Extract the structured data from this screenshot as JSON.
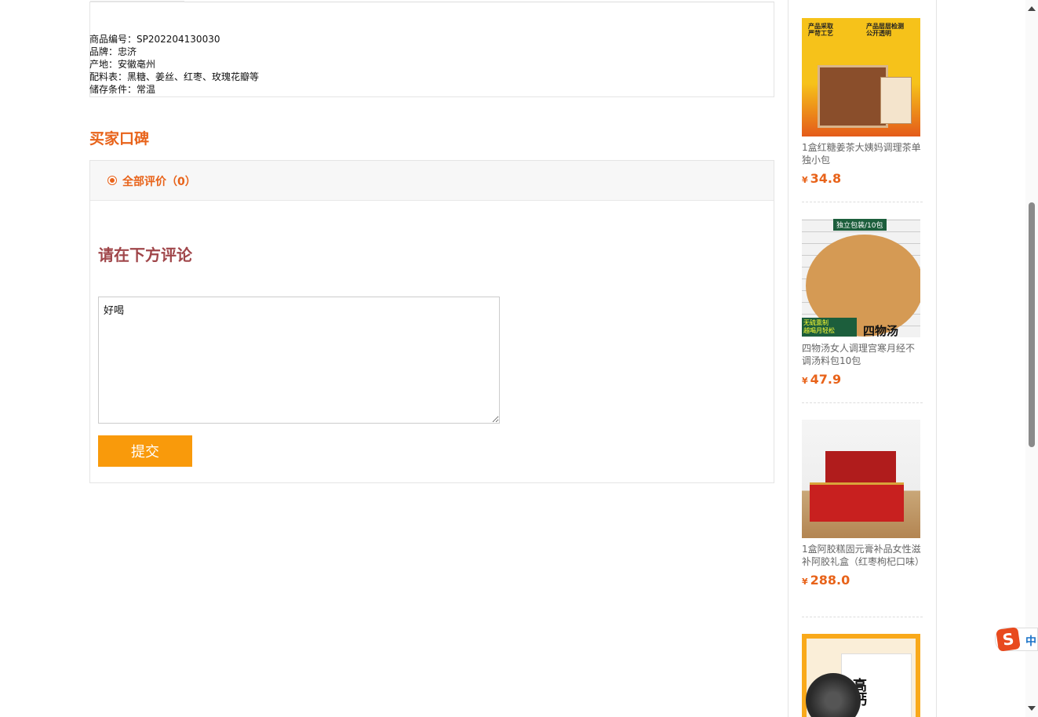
{
  "specs": {
    "code": "商品编号：SP202204130030",
    "brand": "品牌：忠济",
    "origin": "产地：安徽亳州",
    "ingredients": "配料表：黑糖、姜丝、红枣、玫瑰花瓣等",
    "storage": "储存条件：常温"
  },
  "reviews": {
    "title": "买家口碑",
    "tab_all": "全部评价（0）",
    "comment_heading": "请在下方评论",
    "comment_value": "好喝",
    "submit_label": "提交"
  },
  "sidebar": {
    "products": [
      {
        "name": "1盒红糖姜茶大姨妈调理茶单独小包",
        "currency": "¥",
        "price": "34.8",
        "thumb_text_a": "产品采取\n严苛工艺",
        "thumb_text_b": "产品层层检测\n公开透明"
      },
      {
        "name": "四物汤女人调理宫寒月经不调汤料包10包",
        "currency": "¥",
        "price": "47.9",
        "thumb_tag": "独立包装/10包",
        "thumb_title": "四物汤",
        "thumb_badge": "无硫熏制\n越喝月轻松"
      },
      {
        "name": "1盒阿胶糕固元膏补品女性滋补阿胶礼盒（红枣枸杞口味）",
        "currency": "¥",
        "price": "288.0"
      },
      {
        "name": "",
        "thumb_title": "高钙"
      }
    ]
  },
  "ime": {
    "label": "中",
    "logo": "S"
  },
  "colors": {
    "accent": "#e8631a",
    "button": "#f99a0b",
    "heading": "#a0464a"
  }
}
